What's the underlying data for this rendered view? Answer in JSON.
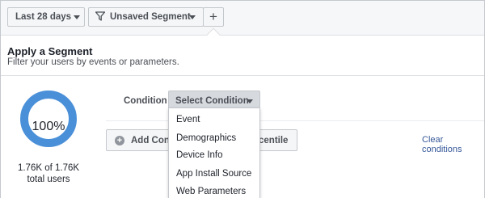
{
  "toolbar": {
    "date_range": "Last 28 days",
    "segment": "Unsaved Segment",
    "add_label": "+"
  },
  "segment_panel": {
    "title": "Apply a Segment",
    "subtitle": "Filter your users by events or parameters."
  },
  "donut": {
    "percent_label": "100%",
    "fraction": 1.0,
    "color": "#4a90d9",
    "users_count": "1.76K of 1.76K",
    "users_label": "total users"
  },
  "condition": {
    "label": "Condition",
    "select_placeholder": "Select Condition"
  },
  "add_button": {
    "left_text": "Add Cond",
    "right_text": "centile"
  },
  "clear_conditions": "Clear conditions",
  "dropdown": {
    "options": [
      "Event",
      "Demographics",
      "Device Info",
      "App Install Source",
      "Web Parameters"
    ]
  }
}
